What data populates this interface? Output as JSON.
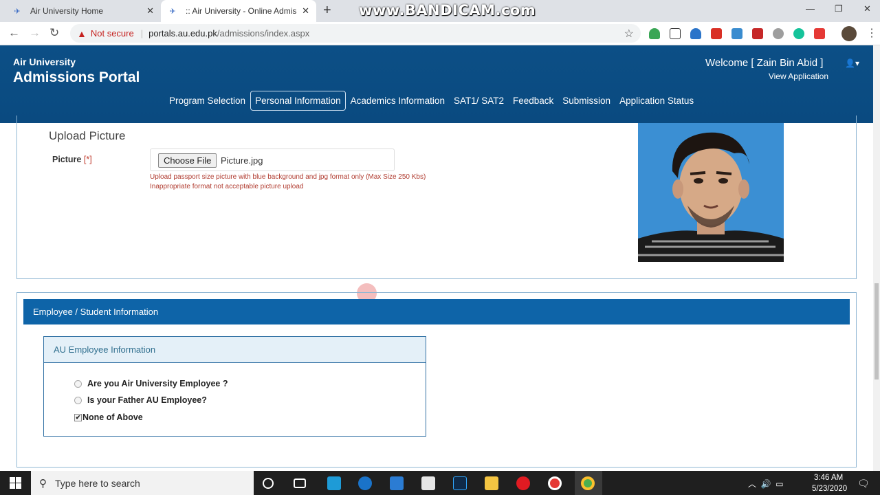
{
  "browser": {
    "tabs": [
      {
        "title": "Air University Home"
      },
      {
        "title": ":: Air University - Online Admissi"
      }
    ],
    "watermark": "www.BANDICAM.com",
    "security": "Not secure",
    "url_host": "portals.au.edu.pk",
    "url_path": "/admissions/index.aspx"
  },
  "header": {
    "brand_small": "Air University",
    "brand_large": "Admissions Portal",
    "welcome": "Welcome [ Zain Bin Abid ]",
    "view_application": "View Application",
    "nav": [
      {
        "label": "Program Selection"
      },
      {
        "label": "Personal Information",
        "active": true
      },
      {
        "label": "Academics Information"
      },
      {
        "label": "SAT1/ SAT2"
      },
      {
        "label": "Feedback"
      },
      {
        "label": "Submission"
      },
      {
        "label": "Application Status"
      }
    ]
  },
  "upload": {
    "title": "Upload Picture",
    "label": "Picture",
    "required_mark": "[*]",
    "button": "Choose File",
    "file_name": "Picture.jpg",
    "hint1": "Upload passport size picture with blue background and jpg format only (Max Size 250 Kbs)",
    "hint2": "Inappropriate format not acceptable picture upload"
  },
  "employee": {
    "section_title": "Employee / Student Information",
    "panel_title": "AU Employee Information",
    "options": [
      {
        "label": "Are you Air University Employee ?",
        "type": "radio",
        "checked": false
      },
      {
        "label": "Is your Father AU Employee?",
        "type": "radio",
        "checked": false
      },
      {
        "label": "None of Above",
        "type": "checkbox",
        "checked": true
      }
    ]
  },
  "taskbar": {
    "search_placeholder": "Type here to search",
    "time": "3:46 AM",
    "date": "5/23/2020"
  },
  "colors": {
    "header_blue": "#0c4f86",
    "section_blue": "#0e64a8",
    "panel_bg": "#e4f0f8",
    "error_red": "#b03a2e"
  }
}
